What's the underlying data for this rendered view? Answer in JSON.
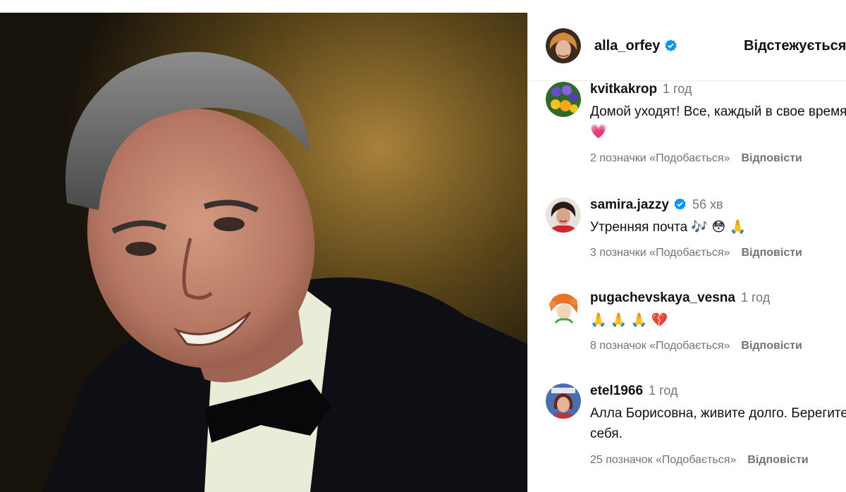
{
  "post": {
    "author": "alla_orfey",
    "follow_label": "Відстежується"
  },
  "comments": [
    {
      "user": "kvitkakrop",
      "time": "1 год",
      "text": "Домой уходят! Все, каждый в свое время 💗",
      "likes": "2 позначки «Подобається»",
      "reply": "Відповісти",
      "verified": false
    },
    {
      "user": "samira.jazzy",
      "time": "56 хв",
      "text": "Утренняя почта 🎶 😳 🙏",
      "likes": "3 позначки «Подобається»",
      "reply": "Відповісти",
      "verified": true
    },
    {
      "user": "pugachevskaya_vesna",
      "time": "1 год",
      "text": "🙏 🙏 🙏 💔",
      "likes": "8 позначок «Подобається»",
      "reply": "Відповісти",
      "verified": false
    },
    {
      "user": "etel1966",
      "time": "1 год",
      "text": "Алла Борисовна, живите долго. Берегите себя.",
      "likes": "25 позначок «Подобається»",
      "reply": "Відповісти",
      "verified": false
    }
  ],
  "colors": {
    "verified_badge": "#0095f6",
    "heart": "#e8456b",
    "secondary_text": "#737373"
  },
  "icons": {
    "verified": "verified-badge-icon"
  }
}
